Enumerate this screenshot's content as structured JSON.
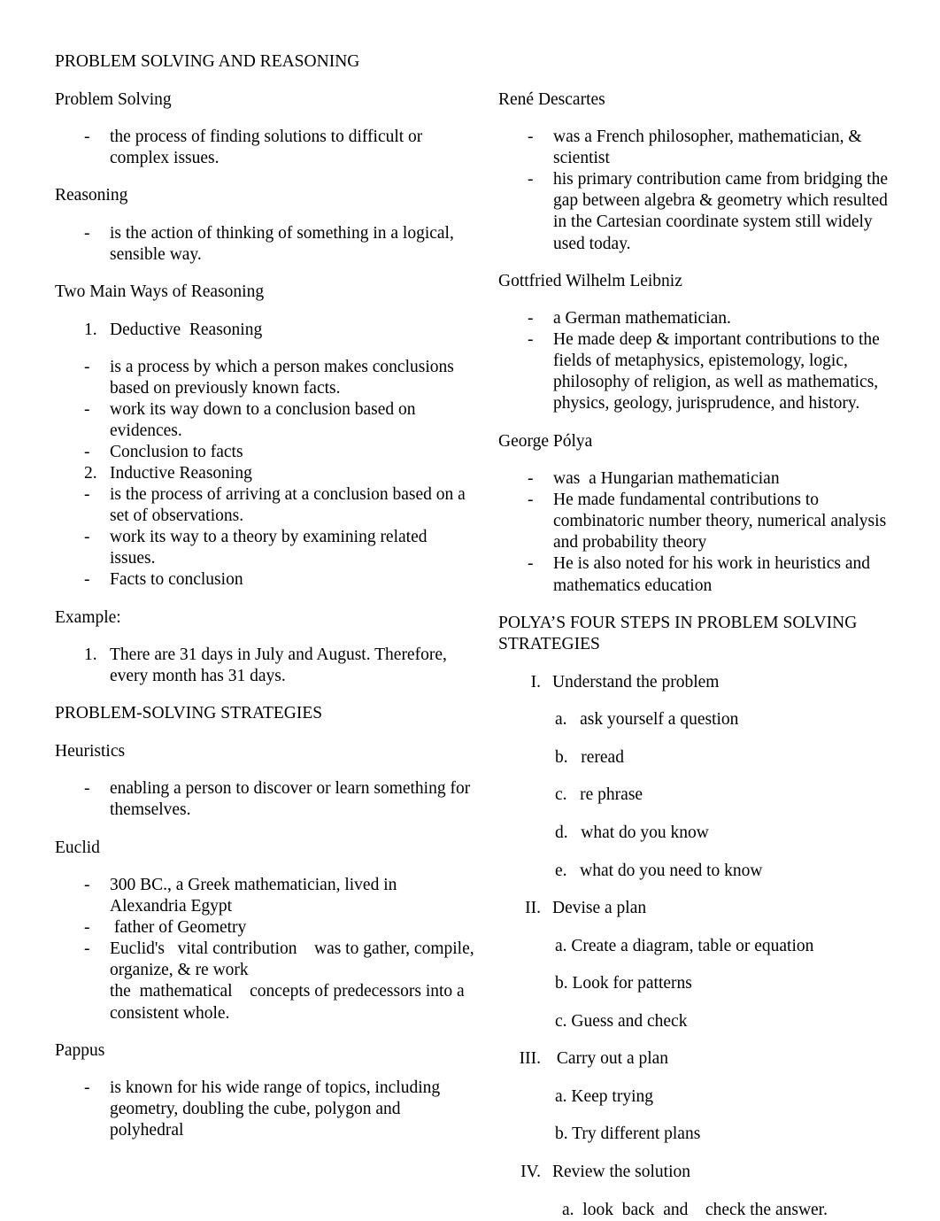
{
  "document": {
    "title": "PROBLEM SOLVING AND REASONING"
  },
  "left_column": {
    "h_problem_solving": "Problem Solving",
    "problem_solving_bullets": [
      "the process of finding solutions to difficult or complex issues."
    ],
    "h_reasoning": "Reasoning",
    "reasoning_bullets": [
      "is the action of thinking of something in a logical, sensible way."
    ],
    "h_two_main_ways": "Two Main Ways of Reasoning",
    "reasoning_types": [
      {
        "marker": "1.",
        "text": "Deductive  Reasoning"
      },
      {
        "marker": "-",
        "text": "is a process by which a person makes conclusions based on previously known facts."
      },
      {
        "marker": "-",
        "text": "work its way down to a conclusion based on evidences."
      },
      {
        "marker": "-",
        "text": "Conclusion to facts"
      },
      {
        "marker": "2.",
        "text": "Inductive Reasoning"
      },
      {
        "marker": "-",
        "text": "is the process of arriving at a conclusion based on a set of observations."
      },
      {
        "marker": "-",
        "text": "work its way to a theory by examining related issues."
      },
      {
        "marker": "-",
        "text": "Facts to conclusion"
      }
    ],
    "h_example": "Example:",
    "example_items": [
      {
        "marker": "1.",
        "text": "There are 31 days in July and August. Therefore, every month has 31 days."
      }
    ],
    "h_strategies": "PROBLEM-SOLVING STRATEGIES",
    "h_heuristics": "Heuristics",
    "heuristics_bullets": [
      "enabling a person to discover or learn something for themselves."
    ],
    "h_euclid": "Euclid",
    "euclid_bullets": [
      "300 BC., a Greek mathematician, lived in Alexandria Egypt",
      " father of Geometry",
      "Euclid's   vital contribution    was to gather, compile, organize, & re work\nthe  mathematical    concepts of predecessors into a consistent whole."
    ],
    "h_pappus": "Pappus",
    "pappus_bullets": [
      "is known for his wide range of topics, including geometry, doubling the cube, polygon and polyhedral"
    ]
  },
  "right_column": {
    "h_descartes": "René Descartes",
    "descartes_bullets": [
      "was a French philosopher, mathematician, & scientist",
      "his primary contribution came from bridging the gap between algebra & geometry which resulted in the Cartesian coordinate system still widely used today."
    ],
    "h_leibniz": "Gottfried Wilhelm Leibniz",
    "leibniz_bullets": [
      "a German mathematician.",
      "He made deep & important contributions to the fields of metaphysics, epistemology, logic, philosophy of religion, as well as mathematics, physics, geology, jurisprudence, and history."
    ],
    "h_polya": "George Pólya",
    "polya_bullets": [
      "was  a Hungarian mathematician",
      "He made fundamental contributions to combinatoric number theory, numerical analysis and probability theory",
      "He is also noted for his work in heuristics and mathematics education"
    ],
    "h_four_steps": "POLYA’S FOUR STEPS IN PROBLEM SOLVING STRATEGIES",
    "steps": [
      {
        "numeral": "I.",
        "title": "Understand the problem",
        "substeps": [
          "a.   ask yourself a question",
          "b.   reread",
          "c.   re phrase",
          "d.   what do you know",
          "e.   what do you need to know"
        ]
      },
      {
        "numeral": "II.",
        "title": "Devise a plan",
        "substeps": [
          "a. Create a diagram, table or equation",
          "b. Look for patterns",
          "c. Guess and check"
        ]
      },
      {
        "numeral": "III.",
        "title": " Carry out a plan",
        "substeps": [
          "a. Keep trying",
          "b. Try different plans"
        ]
      },
      {
        "numeral": "IV.",
        "title": "Review the solution",
        "substeps": [
          "a.  look  back  and    check the answer."
        ]
      }
    ]
  }
}
